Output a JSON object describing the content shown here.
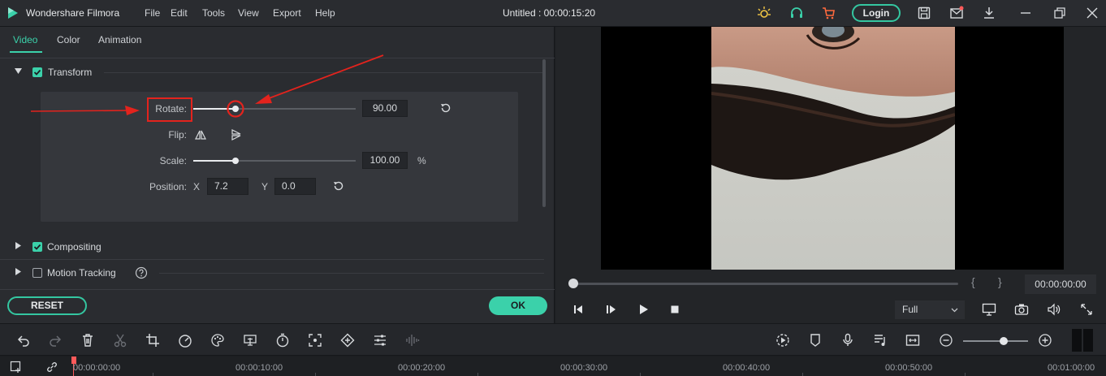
{
  "app": {
    "name": "Wondershare Filmora",
    "document_title": "Untitled : 00:00:15:20",
    "menu": [
      "File",
      "Edit",
      "Tools",
      "View",
      "Export",
      "Help"
    ],
    "login_label": "Login",
    "accent_color": "#3bd1aa"
  },
  "tabs": [
    "Video",
    "Color",
    "Animation"
  ],
  "active_tab": "Video",
  "sections": {
    "transform": {
      "label": "Transform",
      "checked": true,
      "expanded": true
    },
    "compositing": {
      "label": "Compositing",
      "checked": true,
      "expanded": false
    },
    "motion_tracking": {
      "label": "Motion Tracking",
      "checked": false,
      "expanded": false
    }
  },
  "transform": {
    "rotate_label": "Rotate:",
    "rotate_value": "90.00",
    "flip_label": "Flip:",
    "scale_label": "Scale:",
    "scale_value": "100.00",
    "scale_unit": "%",
    "position_label": "Position:",
    "x_label": "X",
    "x_value": "7.2",
    "y_label": "Y",
    "y_value": "0.0"
  },
  "buttons": {
    "reset": "RESET",
    "ok": "OK"
  },
  "preview": {
    "timecode": "00:00:00:00",
    "zoom": "Full",
    "brace_open": "{",
    "brace_close": "}"
  },
  "ruler": {
    "labels": [
      "00:00:00:00",
      "00:00:10:00",
      "00:00:20:00",
      "00:00:30:00",
      "00:00:40:00",
      "00:00:50:00",
      "00:01:00:00"
    ]
  },
  "icons": {
    "title_bar": [
      "sun-icon",
      "headset-icon",
      "cart-icon",
      "save-icon",
      "mail-icon",
      "download-icon",
      "restore-icon",
      "close-icon"
    ],
    "toolbar": [
      "undo-icon",
      "redo-icon",
      "delete-icon",
      "cut-icon",
      "crop-icon",
      "speed-icon",
      "color-icon",
      "freeze-icon",
      "timer-icon",
      "fit-icon",
      "keyframe-icon",
      "adjust-icon",
      "audio-wave-icon",
      "render-icon",
      "marker-icon",
      "mic-icon",
      "voiceover-icon",
      "pip-icon",
      "zoom-out-icon",
      "zoom-in-icon"
    ]
  }
}
